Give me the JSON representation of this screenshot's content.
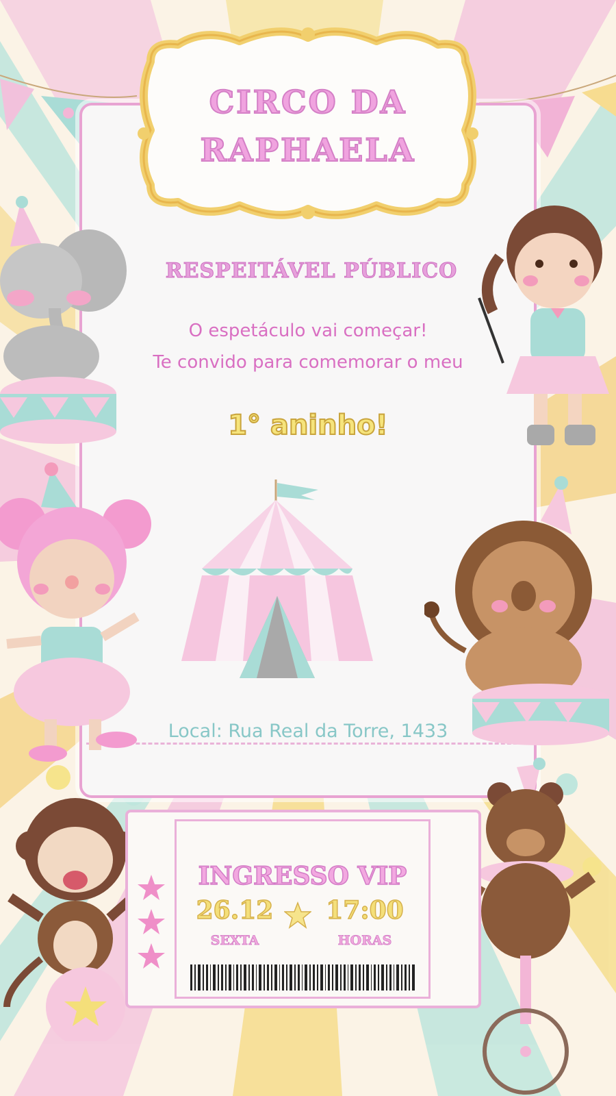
{
  "sign": {
    "title_line1": "CIRCO DA",
    "title_line2": "RAPHAELA"
  },
  "invitation": {
    "subtitle": "RESPEITÁVEL PÚBLICO",
    "line1": "O espetáculo vai começar!",
    "line2": "Te convido para comemorar o meu",
    "age": "1° aninho!",
    "location": "Local: Rua Real da Torre, 1433"
  },
  "ticket": {
    "title": "INGRESSO VIP",
    "date": "26.12",
    "weekday": "SEXTA",
    "time": "17:00",
    "hours_label": "HORAS"
  },
  "colors": {
    "pink": "#f0a3df",
    "yellow": "#f4df7a",
    "teal": "#8fd1cc",
    "card": "#f8f7f7"
  },
  "illustrations": [
    "elephant-icon",
    "girl-ringmaster-icon",
    "clown-girl-icon",
    "circus-tent-icon",
    "lion-icon",
    "monkey-icon",
    "bear-unicycle-icon"
  ]
}
